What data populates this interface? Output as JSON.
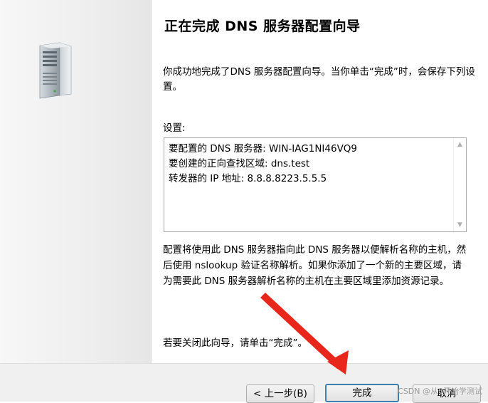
{
  "wizard": {
    "title": "正在完成 DNS 服务器配置向导",
    "intro": "你成功地完成了DNS 服务器配置向导。当你单击“完成”时，会保存下列设置。",
    "settings_label": "设置:",
    "settings_lines": [
      "要配置的 DNS 服务器: WIN-IAG1NI46VQ9",
      "要创建的正向查找区域: dns.test",
      "转发器的 IP 地址: 8.8.8.8223.5.5.5"
    ],
    "explanation": "配置将使用此 DNS 服务器指向此 DNS 服务器以便解析名称的主机，然后使用 nslookup 验证名称解析。如果你添加了一个新的主要区域，请为需要此 DNS 服务器解析名称的主机在主要区域里添加资源记录。",
    "closing": "若要关闭此向导，请单击“完成”。"
  },
  "buttons": {
    "back": "< 上一步(B)",
    "finish": "完成",
    "cancel": "取消"
  },
  "watermark": "CSDN @从0开始学测试",
  "colors": {
    "annotation_arrow": "#e8261c",
    "finish_focus_border": "#3c7fb1"
  },
  "icons": {
    "server": "server-tower-icon",
    "scroll_up": "chevron-up-icon",
    "scroll_down": "chevron-down-icon"
  }
}
